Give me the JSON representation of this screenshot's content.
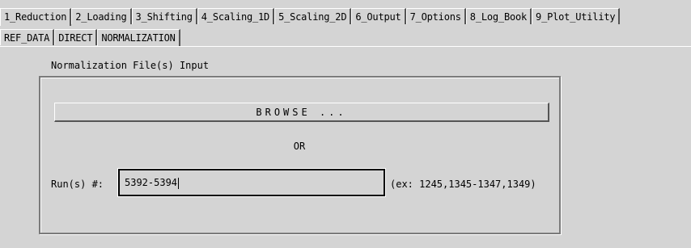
{
  "main_tabs": [
    {
      "label": "1_Reduction",
      "selected": true
    },
    {
      "label": "2_Loading",
      "selected": false
    },
    {
      "label": "3_Shifting",
      "selected": false
    },
    {
      "label": "4_Scaling_1D",
      "selected": false
    },
    {
      "label": "5_Scaling_2D",
      "selected": false
    },
    {
      "label": "6_Output",
      "selected": false
    },
    {
      "label": "7_Options",
      "selected": false
    },
    {
      "label": "8_Log_Book",
      "selected": false
    },
    {
      "label": "9_Plot_Utility",
      "selected": false
    }
  ],
  "sub_tabs": [
    {
      "label": "REF_DATA",
      "selected": false
    },
    {
      "label": "DIRECT",
      "selected": false
    },
    {
      "label": "NORMALIZATION",
      "selected": true
    }
  ],
  "section": {
    "title": "Normalization File(s) Input"
  },
  "browse_label": "BROWSE ...",
  "or_label": "OR",
  "runs": {
    "label": "Run(s) #:",
    "value": "5392-5394",
    "example": "(ex: 1245,1345-1347,1349)"
  }
}
